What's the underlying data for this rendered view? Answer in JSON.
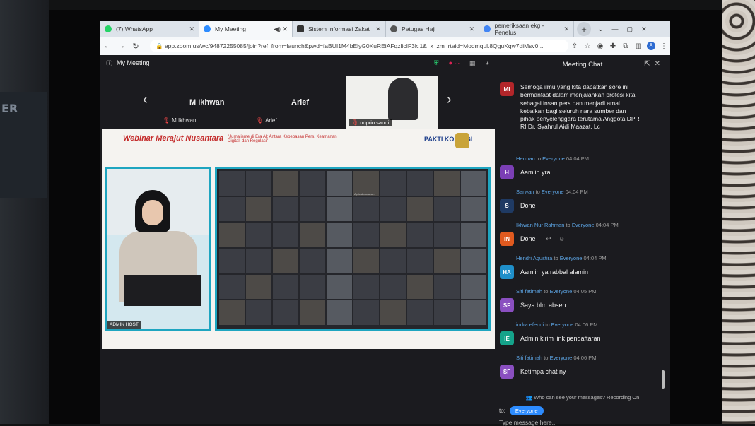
{
  "colors": {
    "accent": "#2d8cff",
    "share_border": "#1ea5c0"
  },
  "browser": {
    "tabs": [
      {
        "label": "(7) WhatsApp",
        "icon": "whatsapp-icon",
        "color": "#25d366"
      },
      {
        "label": "My Meeting",
        "icon": "zoom-icon",
        "color": "#2d8cff"
      },
      {
        "label": "Sistem Informasi Zakat",
        "icon": "diamond-icon",
        "color": "#333"
      },
      {
        "label": "Petugas Haji",
        "icon": "globe-icon",
        "color": "#444"
      },
      {
        "label": "pemeriksaan ekg - Penelus",
        "icon": "google-icon",
        "color": "#4285f4"
      }
    ],
    "url": "app.zoom.us/wc/94872255085/join?ref_from=launch&pwd=faBUI1M4bElyG0KuREiAFqzlicIF3k.1&_x_zm_rtaid=Modmqul.8QguKqw7diMsv0...",
    "profile": "A"
  },
  "meeting": {
    "title": "My Meeting",
    "participants": [
      {
        "name": "M Ikhwan",
        "label": "M Ikhwan"
      },
      {
        "name": "Arief",
        "label": "Arief"
      },
      {
        "name": "",
        "label": "noprio sandi"
      }
    ],
    "share": {
      "banner": "Webinar Merajut Nusantara",
      "subtitle": "\"Jurnalisme di Era AI: Antara Kebebasan Pers, Keamanan Digital, dan Regulasi\"",
      "pakti": "PAKTI KOMDIGI",
      "presenter_label": "ADMIN HOST",
      "gallery_names": [
        "",
        "",
        "",
        "",
        "",
        "Aprizal aurame...",
        "",
        "",
        "",
        "",
        "",
        "",
        "",
        "",
        "",
        "",
        "",
        "",
        "",
        "",
        "",
        "",
        "",
        "",
        "",
        "",
        "",
        "",
        "",
        "",
        "",
        "",
        "",
        "",
        "",
        "",
        "",
        "",
        "",
        "",
        "",
        "",
        "",
        "",
        "",
        "",
        "",
        "",
        "",
        "",
        "",
        "",
        "",
        "",
        "",
        "",
        "",
        "",
        "",
        "",
        ""
      ]
    }
  },
  "chat": {
    "title": "Meeting Chat",
    "first_message": {
      "initials": "MI",
      "color": "#b3262a",
      "text": "Semoga ilmu yang kita dapatkan sore ini bermanfaat dalam menjalankan profesi kita sebagai insan pers dan menjadi amal kebaikan bagi seluruh nara sumber dan pihak penyelenggara terutama Anggota DPR RI Dr. Syahrul Aidi Maazat, Lc"
    },
    "messages": [
      {
        "sender": "Herman",
        "to": "to",
        "recipient": "Everyone",
        "time": "04:04 PM",
        "initials": "H",
        "color": "#7b3fb5",
        "text": "Aamiin yra"
      },
      {
        "sender": "Sarwan",
        "to": "to",
        "recipient": "Everyone",
        "time": "04:04 PM",
        "initials": "S",
        "color": "#1f3a63",
        "text": "Done"
      },
      {
        "sender": "Ikhwan Nur Rahman",
        "to": "to",
        "recipient": "Everyone",
        "time": "04:04 PM",
        "initials": "IN",
        "color": "#e05a1f",
        "text": "Done"
      },
      {
        "sender": "Hendri Agustira",
        "to": "to",
        "recipient": "Everyone",
        "time": "04:04 PM",
        "initials": "HA",
        "color": "#1f8fc9",
        "text": "Aamiin ya rabbal alamin"
      },
      {
        "sender": "Siti fatimah",
        "to": "to",
        "recipient": "Everyone",
        "time": "04:05 PM",
        "initials": "SF",
        "color": "#8a4fc0",
        "text": "Saya blm absen"
      },
      {
        "sender": "indra efendi",
        "to": "to",
        "recipient": "Everyone",
        "time": "04:06 PM",
        "initials": "IE",
        "color": "#15a38a",
        "text": "Admin kirim link pendaftaran"
      },
      {
        "sender": "Siti fatimah",
        "to": "to",
        "recipient": "Everyone",
        "time": "04:06 PM",
        "initials": "SF",
        "color": "#8a4fc0",
        "text": "Ketimpa chat ny"
      }
    ],
    "privacy_note": "Who can see your messages? Recording On",
    "to_label": "to:",
    "recipient": "Everyone",
    "input_placeholder": "Type message here..."
  }
}
